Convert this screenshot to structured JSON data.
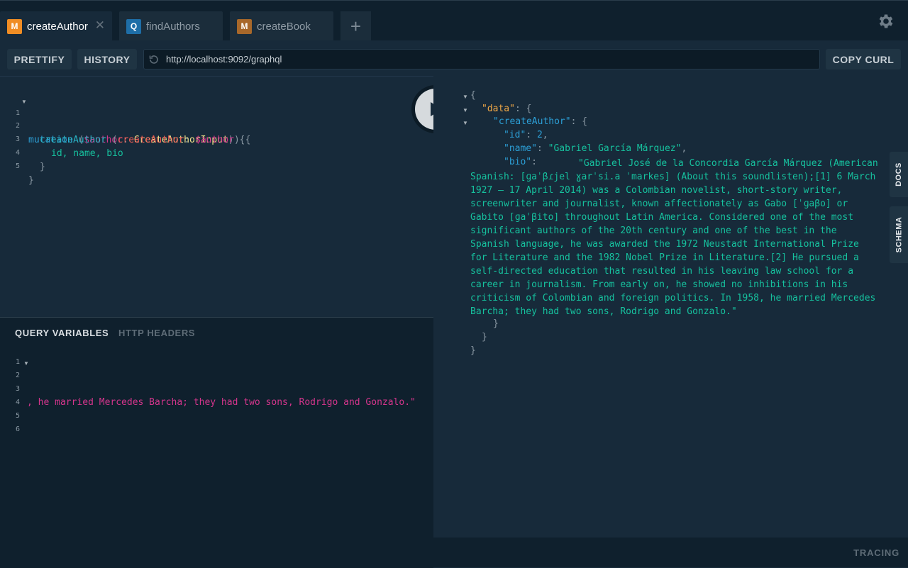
{
  "tabs": [
    {
      "badge": "M",
      "label": "createAuthor",
      "badge_color": "#f08d24",
      "active": true
    },
    {
      "badge": "Q",
      "label": "findAuthors",
      "badge_color": "#1e6ea7",
      "active": false
    },
    {
      "badge": "M",
      "label": "createBook",
      "badge_color": "#a8682a",
      "active": false
    }
  ],
  "tab_close": "✕",
  "tab_add": "+",
  "toolbar": {
    "prettify": "PRETTIFY",
    "history": "HISTORY",
    "url": "http://localhost:9092/graphql",
    "copy_curl": "COPY CURL"
  },
  "editor": {
    "line_numbers": [
      "1",
      "2",
      "3",
      "4",
      "5"
    ],
    "line1": {
      "kw": "mutation",
      "open": " (",
      "var": "$author",
      "colon": ": ",
      "type": "CreateAuthorInput",
      "close": ") {"
    },
    "line2": {
      "field": "createAuthor",
      "open": " (",
      "arg": "createAuthor",
      "colon": ": ",
      "var": "$author",
      "close": ") {"
    },
    "line3": "id, name, bio",
    "line4": "}",
    "line5": "}"
  },
  "variables": {
    "tab_query_variables": "QUERY VARIABLES",
    "tab_http_headers": "HTTP HEADERS",
    "line_numbers": [
      "1",
      "2",
      "3",
      "4",
      "5",
      "6"
    ],
    "line4_text": ", he married Mercedes Barcha; they had two sons, Rodrigo and Gonzalo.\""
  },
  "result": {
    "open": "{",
    "data_key": "\"data\"",
    "create_author_key": "\"createAuthor\"",
    "id_key": "\"id\"",
    "id_value": "2",
    "name_key": "\"name\"",
    "name_value": "\"Gabriel García Márquez\"",
    "bio_key": "\"bio\"",
    "bio_value": "\"Gabriel José de la Concordia García Márquez (American Spanish: [ɡaˈβɾjel ɣarˈsi.a ˈmarkes] (About this soundlisten);[1] 6 March 1927 – 17 April 2014) was a Colombian novelist, short-story writer, screenwriter and journalist, known affectionately as Gabo [ˈɡaβo] or Gabito [ɡaˈβito] throughout Latin America. Considered one of the most significant authors of the 20th century and one of the best in the Spanish language, he was awarded the 1972 Neustadt International Prize for Literature and the 1982 Nobel Prize in Literature.[2] He pursued a self-directed education that resulted in his leaving law school for a career in journalism. From early on, he showed no inhibitions in his criticism of Colombian and foreign politics. In 1958, he married Mercedes Barcha; they had two sons, Rodrigo and Gonzalo.\""
  },
  "side": {
    "docs": "DOCS",
    "schema": "SCHEMA"
  },
  "footer": {
    "tracing": "TRACING"
  },
  "colors": {
    "accent_mutation": "#f08d24",
    "accent_query": "#1e6ea7",
    "string": "#16c19e",
    "variable": "#d4358c"
  }
}
